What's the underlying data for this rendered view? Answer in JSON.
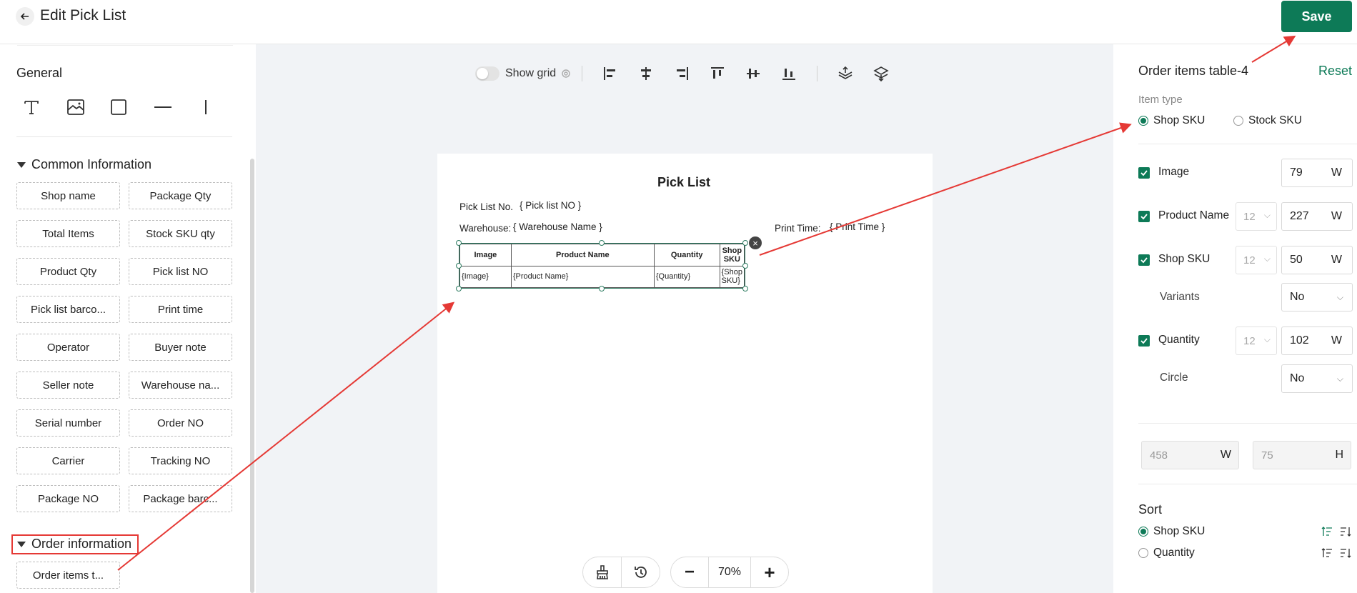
{
  "header": {
    "title": "Edit Pick List",
    "save_label": "Save"
  },
  "left": {
    "general_title": "General",
    "tools": [
      "text-tool-icon",
      "image-tool-icon",
      "rectangle-tool-icon",
      "horizontal-line-tool-icon",
      "vertical-line-tool-icon"
    ],
    "common_title": "Common Information",
    "common_fields": [
      "Shop name",
      "Package Qty",
      "Total Items",
      "Stock SKU qty",
      "Product Qty",
      "Pick list NO",
      "Pick list barco...",
      "Print time",
      "Operator",
      "Buyer note",
      "Seller note",
      "Warehouse na...",
      "Serial number",
      "Order NO",
      "Carrier",
      "Tracking NO",
      "Package NO",
      "Package barc..."
    ],
    "order_title": "Order information",
    "order_fields": [
      "Order items t..."
    ]
  },
  "toolbar": {
    "show_grid_label": "Show grid"
  },
  "paper": {
    "title": "Pick List",
    "pick_list_no_label": "Pick List No.",
    "pick_list_no_value": "{ Pick list NO }",
    "warehouse_label": "Warehouse:",
    "warehouse_value": "{ Warehouse Name }",
    "print_time_label": "Print Time:",
    "print_time_value": "{ Print Time }",
    "table": {
      "headers": [
        "Image",
        "Product Name",
        "Quantity",
        "Shop SKU"
      ],
      "row": [
        "{Image}",
        "{Product Name}",
        "{Quantity}",
        "{Shop SKU}"
      ]
    }
  },
  "zoom": {
    "value": "70%",
    "minus": "−",
    "plus": "+"
  },
  "right": {
    "title": "Order items table-4",
    "reset_label": "Reset",
    "item_type_label": "Item type",
    "item_type_options": [
      "Shop SKU",
      "Stock SKU"
    ],
    "columns": [
      {
        "label": "Image",
        "width": "79",
        "unit": "W"
      },
      {
        "label": "Product Name",
        "font_size": "12",
        "width": "227",
        "unit": "W"
      },
      {
        "label": "Shop SKU",
        "font_size": "12",
        "width": "50",
        "unit": "W"
      },
      {
        "label": "Quantity",
        "font_size": "12",
        "width": "102",
        "unit": "W"
      }
    ],
    "variants_label": "Variants",
    "variants_value": "No",
    "circle_label": "Circle",
    "circle_value": "No",
    "table_width": "458",
    "table_width_unit": "W",
    "table_height": "75",
    "table_height_unit": "H",
    "sort_title": "Sort",
    "sort_options": [
      "Shop SKU",
      "Quantity"
    ]
  },
  "colors": {
    "accent": "#0d7a57",
    "annotation": "#e53935"
  }
}
